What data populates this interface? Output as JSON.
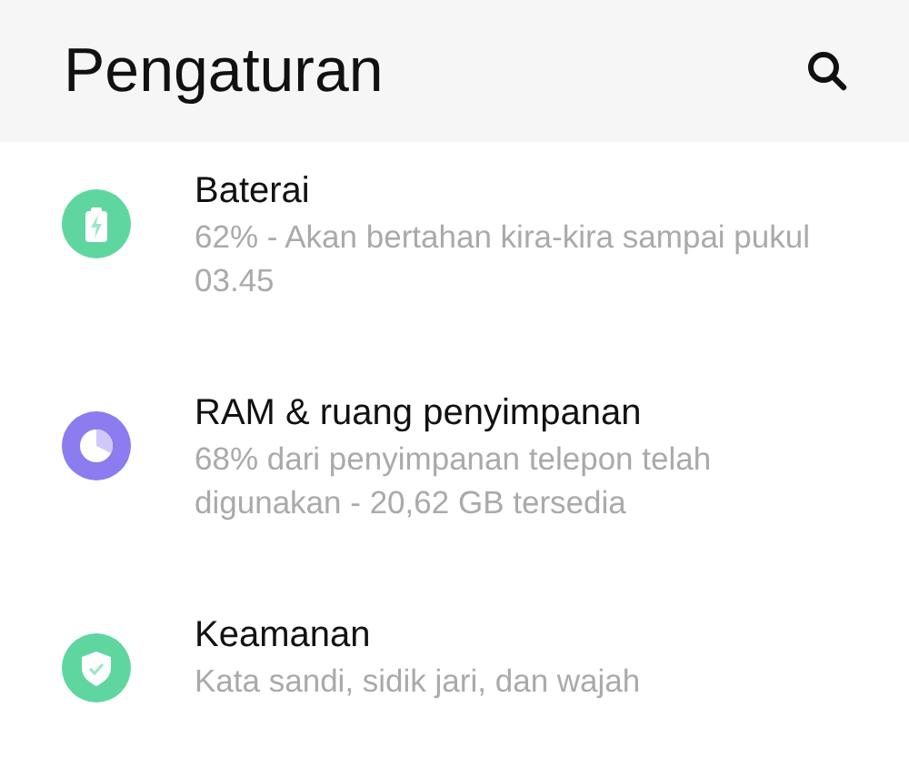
{
  "header": {
    "title": "Pengaturan"
  },
  "items": [
    {
      "kind": "battery",
      "color": "#5fd6a0",
      "title": "Baterai",
      "subtitle": "62% - Akan bertahan kira-kira sampai pukul 03.45"
    },
    {
      "kind": "storage",
      "color": "#8b7cf0",
      "title": "RAM & ruang penyimpanan",
      "subtitle": "68% dari penyimpanan telepon telah digunakan - 20,62 GB tersedia"
    },
    {
      "kind": "security",
      "color": "#5fd6a0",
      "title": "Keamanan",
      "subtitle": "Kata sandi, sidik jari, dan wajah"
    }
  ]
}
